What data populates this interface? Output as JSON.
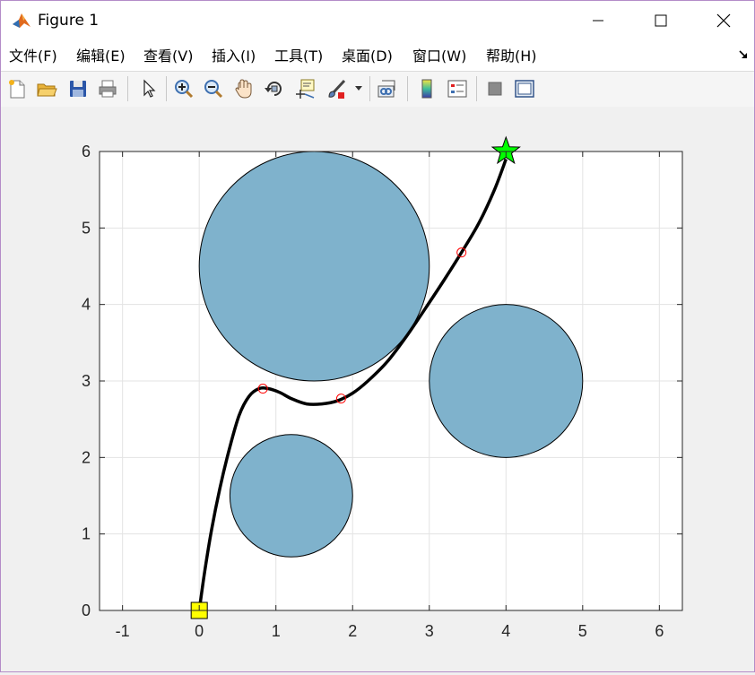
{
  "window": {
    "title": "Figure 1",
    "controls": {
      "minimize": "minimize-icon",
      "maximize": "maximize-icon",
      "close": "close-icon"
    }
  },
  "menubar": {
    "items": [
      {
        "label": "文件(F)"
      },
      {
        "label": "编辑(E)"
      },
      {
        "label": "查看(V)"
      },
      {
        "label": "插入(I)"
      },
      {
        "label": "工具(T)"
      },
      {
        "label": "桌面(D)"
      },
      {
        "label": "窗口(W)"
      },
      {
        "label": "帮助(H)"
      }
    ],
    "corner_icon": "dock-arrow-icon"
  },
  "toolbar": {
    "buttons": [
      "new-figure-icon",
      "open-file-icon",
      "save-icon",
      "print-icon",
      "select-arrow-icon",
      "zoom-in-icon",
      "zoom-out-icon",
      "pan-hand-icon",
      "rotate-3d-icon",
      "data-cursor-icon",
      "brush-icon",
      "link-plot-icon",
      "colorbar-icon",
      "legend-icon",
      "hide-plot-tools-icon",
      "show-plot-tools-icon"
    ]
  },
  "colors": {
    "obstacle_fill": "#7fb2cc",
    "path": "#000000",
    "waypoint": "#ff0000",
    "start": "#ffff00",
    "goal": "#00ff00"
  },
  "chart_data": {
    "type": "scatter",
    "title": "",
    "xlabel": "",
    "ylabel": "",
    "xlim": [
      -1.3,
      6.3
    ],
    "ylim": [
      0,
      6
    ],
    "xticks": [
      "-1",
      "0",
      "1",
      "2",
      "3",
      "4",
      "5",
      "6"
    ],
    "yticks": [
      "0",
      "1",
      "2",
      "3",
      "4",
      "5",
      "6"
    ],
    "grid": true,
    "obstacles": [
      {
        "name": "obstacle-large",
        "cx": 1.5,
        "cy": 4.5,
        "r": 1.5
      },
      {
        "name": "obstacle-right",
        "cx": 4.0,
        "cy": 3.0,
        "r": 1.0
      },
      {
        "name": "obstacle-bottom",
        "cx": 1.2,
        "cy": 1.5,
        "r": 0.8
      }
    ],
    "start": [
      0,
      0
    ],
    "goal": [
      4,
      6
    ],
    "waypoints": [
      [
        0.83,
        2.9
      ],
      [
        1.85,
        2.77
      ],
      [
        3.42,
        4.68
      ]
    ],
    "path": [
      [
        0,
        0
      ],
      [
        0.07,
        0.5
      ],
      [
        0.16,
        1.05
      ],
      [
        0.27,
        1.6
      ],
      [
        0.39,
        2.1
      ],
      [
        0.52,
        2.55
      ],
      [
        0.65,
        2.8
      ],
      [
        0.78,
        2.9
      ],
      [
        0.9,
        2.9
      ],
      [
        1.05,
        2.85
      ],
      [
        1.2,
        2.77
      ],
      [
        1.4,
        2.7
      ],
      [
        1.6,
        2.7
      ],
      [
        1.8,
        2.74
      ],
      [
        2.0,
        2.84
      ],
      [
        2.2,
        3.0
      ],
      [
        2.45,
        3.25
      ],
      [
        2.7,
        3.58
      ],
      [
        2.95,
        3.95
      ],
      [
        3.2,
        4.33
      ],
      [
        3.42,
        4.68
      ],
      [
        3.65,
        5.07
      ],
      [
        3.85,
        5.5
      ],
      [
        4.0,
        5.9
      ]
    ]
  }
}
